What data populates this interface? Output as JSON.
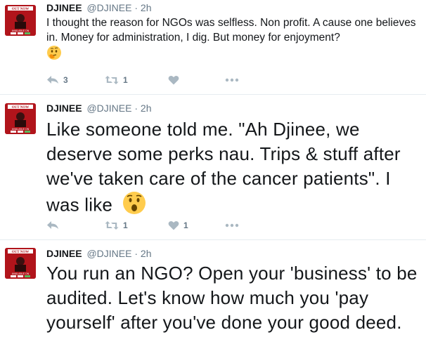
{
  "tweets": [
    {
      "name": "DJINEE",
      "handle": "@DJINEE",
      "separator": "·",
      "time": "2h",
      "text": "I thought the reason for NGOs was selfless. Non profit. A cause one believes in. Money for administration, I dig. But money for enjoyment?",
      "emoji": "thinking-face",
      "reply_count": "3",
      "retweet_count": "1",
      "like_count": ""
    },
    {
      "name": "DJINEE",
      "handle": "@DJINEE",
      "separator": "·",
      "time": "2h",
      "text": "Like someone told me. \"Ah Djinee, we deserve some perks nau. Trips & stuff after we've taken care of the cancer patients\". I was like",
      "emoji": "hushed-face",
      "reply_count": "",
      "retweet_count": "1",
      "like_count": "1"
    },
    {
      "name": "DJINEE",
      "handle": "@DJINEE",
      "separator": "·",
      "time": "2h",
      "text": "You run an NGO? Open your 'business' to be audited. Let's know how much you 'pay yourself' after you've done your good deed.",
      "emoji": "",
      "reply_count": "",
      "retweet_count": "",
      "like_count": ""
    }
  ],
  "avatar": {
    "top_text": "OUT NOW",
    "bottom_text": "AVAILABLE ON",
    "color": "#b1141b"
  },
  "colors": {
    "text": "#14171a",
    "muted": "#657786",
    "icon": "#aab8c2",
    "divider": "#e6ecf0"
  }
}
